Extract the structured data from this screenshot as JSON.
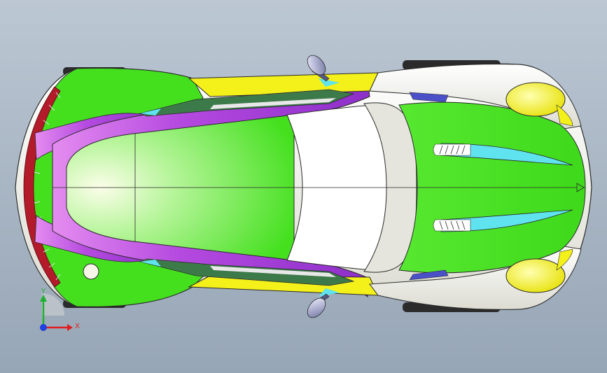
{
  "viewport": {
    "background_top": "#bcc7d3",
    "background_bottom": "#97a6b6"
  },
  "model": {
    "part_colors": {
      "body_green": "#44e01e",
      "body_light_green": "#8ff27a",
      "roof_highlight": "#f4fbe6",
      "body_white": "#f3f3ec",
      "accent_purple": "#a43bdc",
      "trim_yellow": "#f4f01a",
      "vent_cyan": "#5fe3ee",
      "vent_blue": "#4a50c8",
      "mirror_gray": "#8a8fb4",
      "glass_dark": "#3d7a4a",
      "tail_red": "#b31a2a",
      "edge_line": "#2a2a2a"
    }
  },
  "triad": {
    "x_label": "X",
    "y_label": "Y",
    "x_color": "#e02020",
    "y_color": "#20b030",
    "z_color": "#2040e0"
  }
}
